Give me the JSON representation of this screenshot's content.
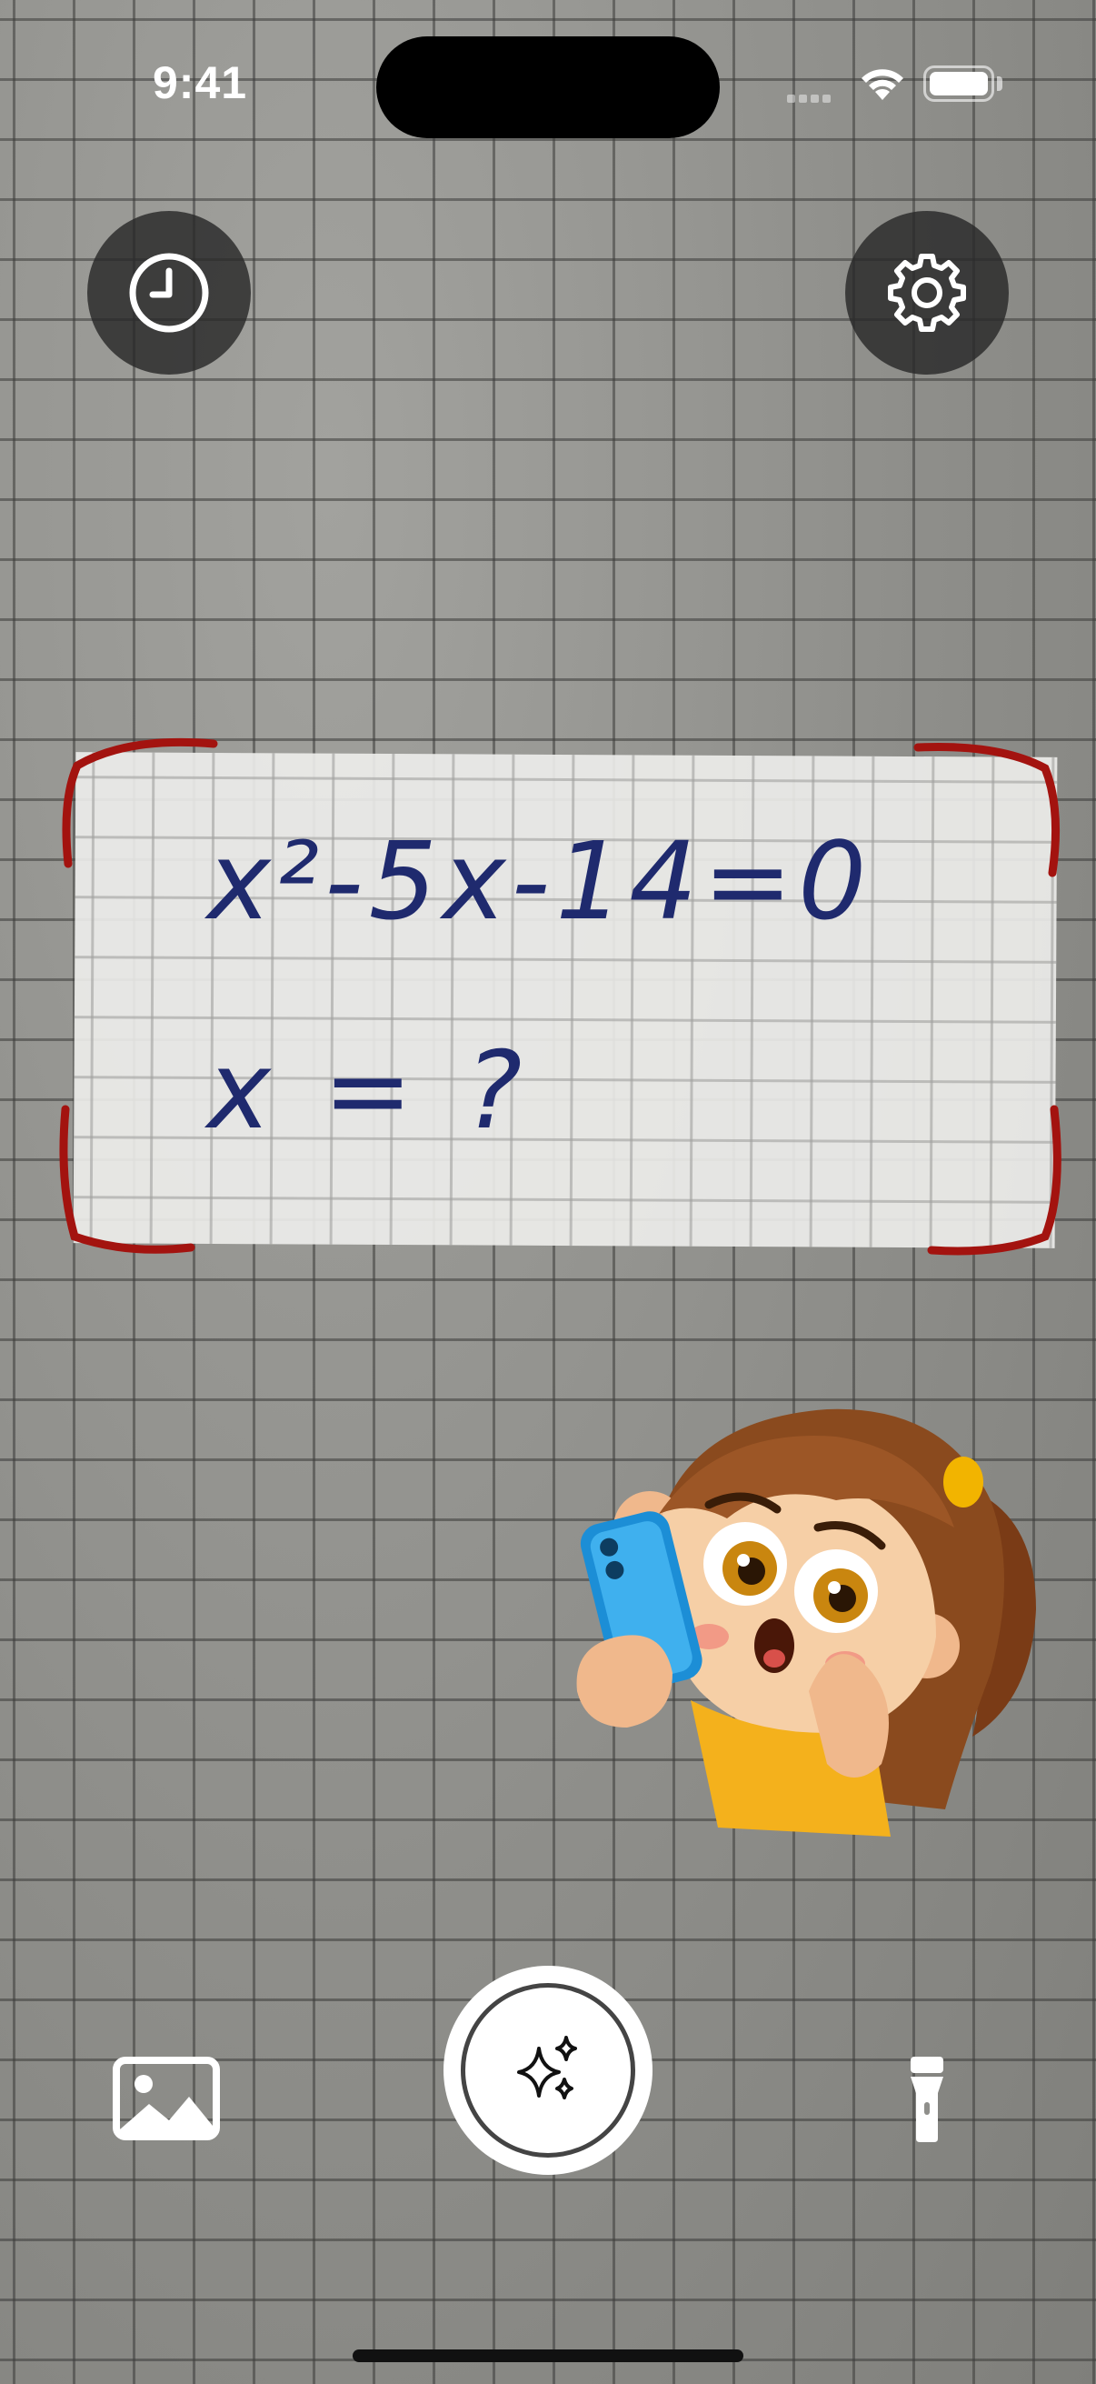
{
  "status_bar": {
    "time": "9:41"
  },
  "scan": {
    "equation": "x²-5x-14=0",
    "question": "x = ?"
  },
  "colors": {
    "scan_frame": "#a3130f",
    "ink": "#1f2a6e",
    "button_bg": "#282828"
  },
  "controls": {
    "top_left_icon": "clock-history-icon",
    "top_right_icon": "gear-icon",
    "bottom_left_icon": "photo-gallery-icon",
    "center_icon": "sparkles-icon",
    "bottom_right_icon": "flashlight-icon"
  }
}
